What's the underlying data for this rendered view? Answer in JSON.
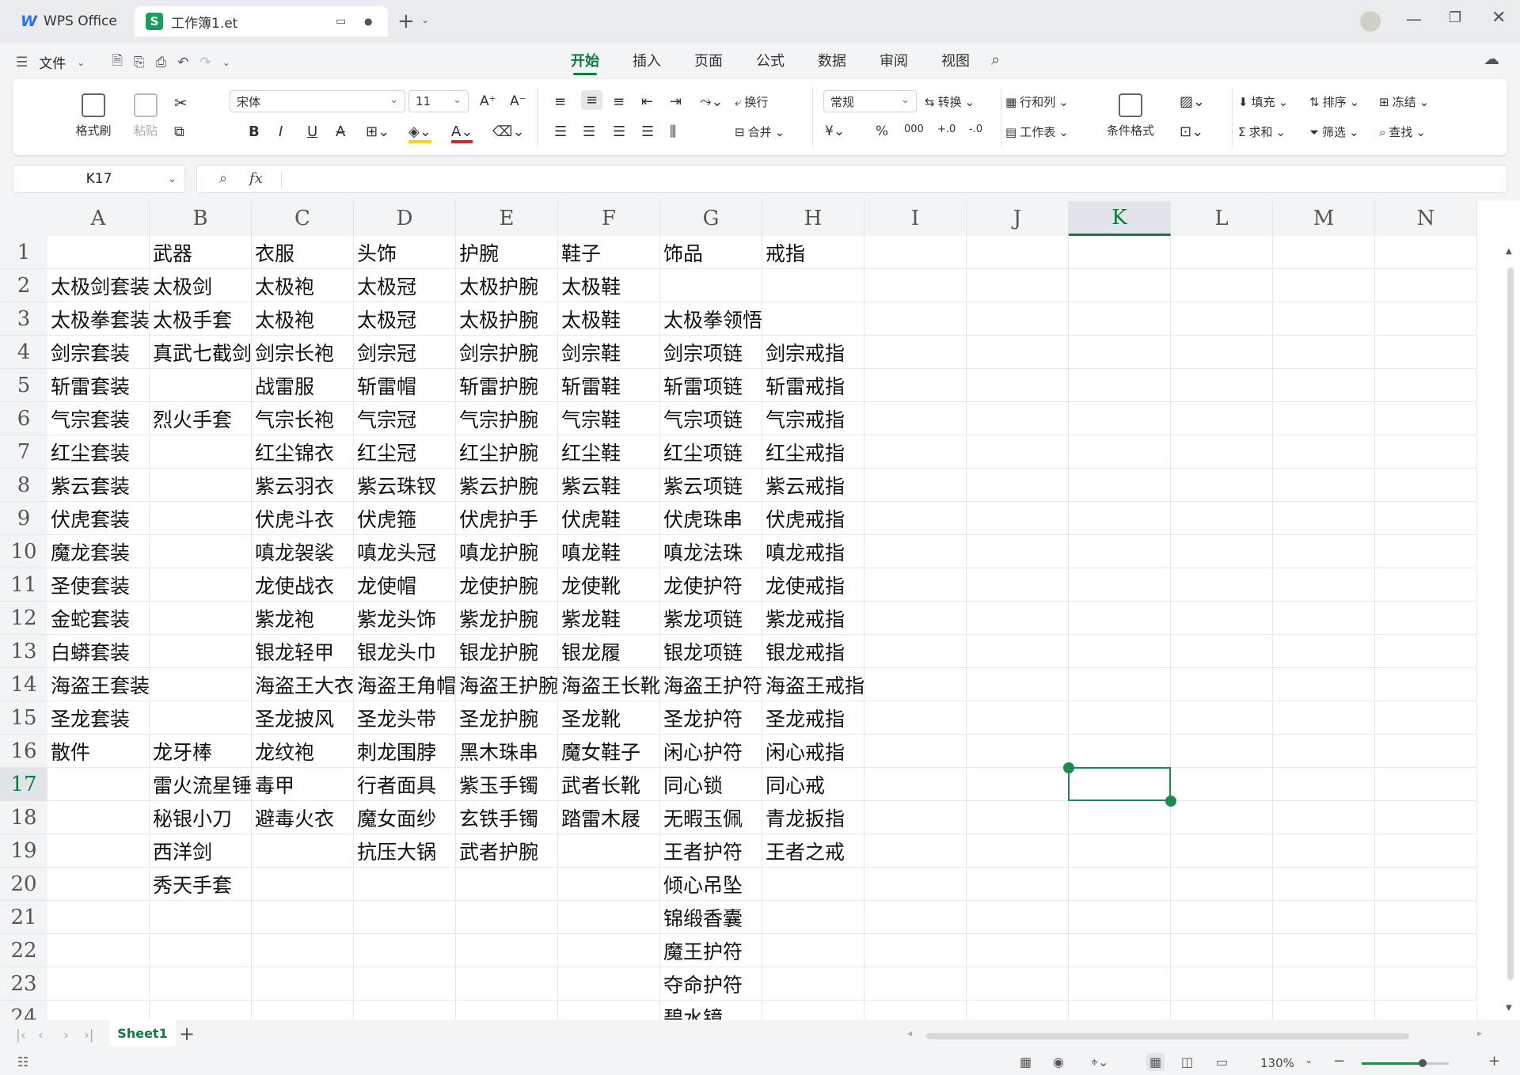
{
  "tabs": {
    "app": "WPS Office",
    "doc": "工作簿1.et"
  },
  "menu": {
    "file": "文件",
    "tabs": [
      "开始",
      "插入",
      "页面",
      "公式",
      "数据",
      "审阅",
      "视图"
    ]
  },
  "ribbon": {
    "format_painter": "格式刷",
    "paste": "粘贴",
    "font": "宋体",
    "size": "11",
    "wrap": "换行",
    "merge": "合并",
    "number_format": "常规",
    "convert": "转换",
    "rows_cols": "行和列",
    "worksheet": "工作表",
    "cond_format": "条件格式",
    "fill": "填充",
    "sort": "排序",
    "freeze": "冻结",
    "sum": "求和",
    "filter": "筛选",
    "find": "查找"
  },
  "namebox": "K17",
  "fx": "fx",
  "columns": [
    "A",
    "B",
    "C",
    "D",
    "E",
    "F",
    "G",
    "H",
    "I",
    "J",
    "K",
    "L",
    "M",
    "N"
  ],
  "active_col": "K",
  "active_row": "17",
  "rows": [
    [
      "",
      "武器",
      "衣服",
      "头饰",
      "护腕",
      "鞋子",
      "饰品",
      "戒指"
    ],
    [
      "太极剑套装",
      "太极剑",
      "太极袍",
      "太极冠",
      "太极护腕",
      "太极鞋",
      "",
      ""
    ],
    [
      "太极拳套装",
      "太极手套",
      "太极袍",
      "太极冠",
      "太极护腕",
      "太极鞋",
      "太极拳领悟",
      ""
    ],
    [
      "剑宗套装",
      "真武七截剑",
      "剑宗长袍",
      "剑宗冠",
      "剑宗护腕",
      "剑宗鞋",
      "剑宗项链",
      "剑宗戒指"
    ],
    [
      "斩雷套装",
      "",
      "战雷服",
      "斩雷帽",
      "斩雷护腕",
      "斩雷鞋",
      "斩雷项链",
      "斩雷戒指"
    ],
    [
      "气宗套装",
      "烈火手套",
      "气宗长袍",
      "气宗冠",
      "气宗护腕",
      "气宗鞋",
      "气宗项链",
      "气宗戒指"
    ],
    [
      "红尘套装",
      "",
      "红尘锦衣",
      "红尘冠",
      "红尘护腕",
      "红尘鞋",
      "红尘项链",
      "红尘戒指"
    ],
    [
      "紫云套装",
      "",
      "紫云羽衣",
      "紫云珠钗",
      "紫云护腕",
      "紫云鞋",
      "紫云项链",
      "紫云戒指"
    ],
    [
      "伏虎套装",
      "",
      "伏虎斗衣",
      "伏虎箍",
      "伏虎护手",
      "伏虎鞋",
      "伏虎珠串",
      "伏虎戒指"
    ],
    [
      "魔龙套装",
      "",
      "嗔龙袈裟",
      "嗔龙头冠",
      "嗔龙护腕",
      "嗔龙鞋",
      "嗔龙法珠",
      "嗔龙戒指"
    ],
    [
      "圣使套装",
      "",
      "龙使战衣",
      "龙使帽",
      "龙使护腕",
      "龙使靴",
      "龙使护符",
      "龙使戒指"
    ],
    [
      "金蛇套装",
      "",
      "紫龙袍",
      "紫龙头饰",
      "紫龙护腕",
      "紫龙鞋",
      "紫龙项链",
      "紫龙戒指"
    ],
    [
      "白蟒套装",
      "",
      "银龙轻甲",
      "银龙头巾",
      "银龙护腕",
      "银龙履",
      "银龙项链",
      "银龙戒指"
    ],
    [
      "海盗王套装",
      "",
      "海盗王大衣",
      "海盗王角帽",
      "海盗王护腕",
      "海盗王长靴",
      "海盗王护符",
      "海盗王戒指"
    ],
    [
      "圣龙套装",
      "",
      "圣龙披风",
      "圣龙头带",
      "圣龙护腕",
      "圣龙靴",
      "圣龙护符",
      "圣龙戒指"
    ],
    [
      "散件",
      "龙牙棒",
      "龙纹袍",
      "刺龙围脖",
      "黑木珠串",
      "魔女鞋子",
      "闲心护符",
      "闲心戒指"
    ],
    [
      "",
      "雷火流星锤",
      "毒甲",
      "行者面具",
      "紫玉手镯",
      "武者长靴",
      "同心锁",
      "同心戒"
    ],
    [
      "",
      "秘银小刀",
      "避毒火衣",
      "魔女面纱",
      "玄铁手镯",
      "踏雷木屐",
      "无暇玉佩",
      "青龙扳指"
    ],
    [
      "",
      "西洋剑",
      "",
      "抗压大锅",
      "武者护腕",
      "",
      "王者护符",
      "王者之戒"
    ],
    [
      "",
      "秀天手套",
      "",
      "",
      "",
      "",
      "倾心吊坠",
      ""
    ],
    [
      "",
      "",
      "",
      "",
      "",
      "",
      "锦缎香囊",
      ""
    ],
    [
      "",
      "",
      "",
      "",
      "",
      "",
      "魔王护符",
      ""
    ],
    [
      "",
      "",
      "",
      "",
      "",
      "",
      "夺命护符",
      ""
    ],
    [
      "",
      "",
      "",
      "",
      "",
      "",
      "碧水镜",
      ""
    ]
  ],
  "sheet": {
    "name": "Sheet1"
  },
  "status": {
    "zoom": "130%"
  },
  "colors": {
    "accent": "#0e7a3e",
    "selection": "#1f8a4c"
  }
}
